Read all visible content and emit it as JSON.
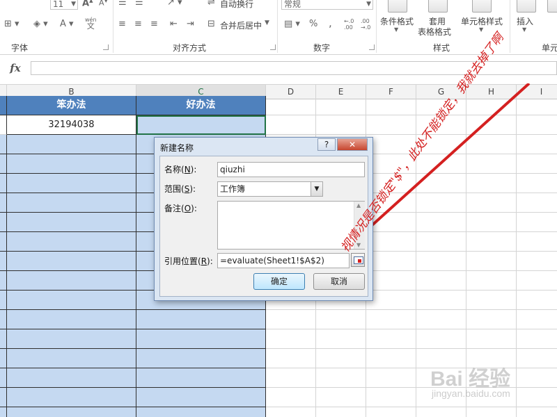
{
  "ribbon": {
    "font_size_value": "11",
    "number_format_value": "常规",
    "wrap_text_label": "自动换行",
    "merge_center_label": "合并后居中",
    "conditional_format_label": "条件格式",
    "table_format_label_1": "套用",
    "table_format_label_2": "表格格式",
    "cell_styles_label": "单元格样式",
    "insert_label": "插入",
    "font_group_label": "字体",
    "alignment_group_label": "对齐方式",
    "number_group_label": "数字",
    "styles_group_label": "样式",
    "cells_group_label": "单元",
    "wen_label": "wén",
    "wen_char": "文",
    "percent_symbol": "%",
    "comma_symbol": ",",
    "increase_decimal": "←.0\n.00",
    "decrease_decimal": ".00\n→.0"
  },
  "formula_bar": {
    "fx_label": "fx",
    "value": ""
  },
  "columns": [
    {
      "label": "B",
      "selected": false
    },
    {
      "label": "C",
      "selected": true
    },
    {
      "label": "D",
      "selected": false
    },
    {
      "label": "E",
      "selected": false
    },
    {
      "label": "F",
      "selected": false
    },
    {
      "label": "G",
      "selected": false
    },
    {
      "label": "H",
      "selected": false
    },
    {
      "label": "I",
      "selected": false
    }
  ],
  "sheet": {
    "header_b": "笨办法",
    "header_c": "好办法",
    "b2_value": "32194038"
  },
  "dialog": {
    "title": "新建名称",
    "help_label": "?",
    "close_label": "✕",
    "name_label_prefix": "名称(",
    "name_label_key": "N",
    "name_label_suffix": "):",
    "name_value": "qiuzhi",
    "scope_label_prefix": "范围(",
    "scope_label_key": "S",
    "scope_label_suffix": "):",
    "scope_value": "工作簿",
    "comment_label_prefix": "备注(",
    "comment_label_key": "O",
    "comment_label_suffix": "):",
    "comment_value": "",
    "refers_label_prefix": "引用位置(",
    "refers_label_key": "R",
    "refers_label_suffix": "):",
    "refers_value": "=evaluate(Sheet1!$A$2)",
    "ok_label": "确定",
    "cancel_label": "取消"
  },
  "annotation": {
    "text": "视情况是否锁定\"$\"，此处不能锁定，我就去掉了啊",
    "color": "#d42020"
  },
  "watermark": {
    "logo_text": "Bai 经验",
    "url_text": "jingyan.baidu.com"
  },
  "colors": {
    "header_blue": "#4f81bd",
    "cell_blue": "#c5d9f1",
    "excel_green": "#217346"
  }
}
